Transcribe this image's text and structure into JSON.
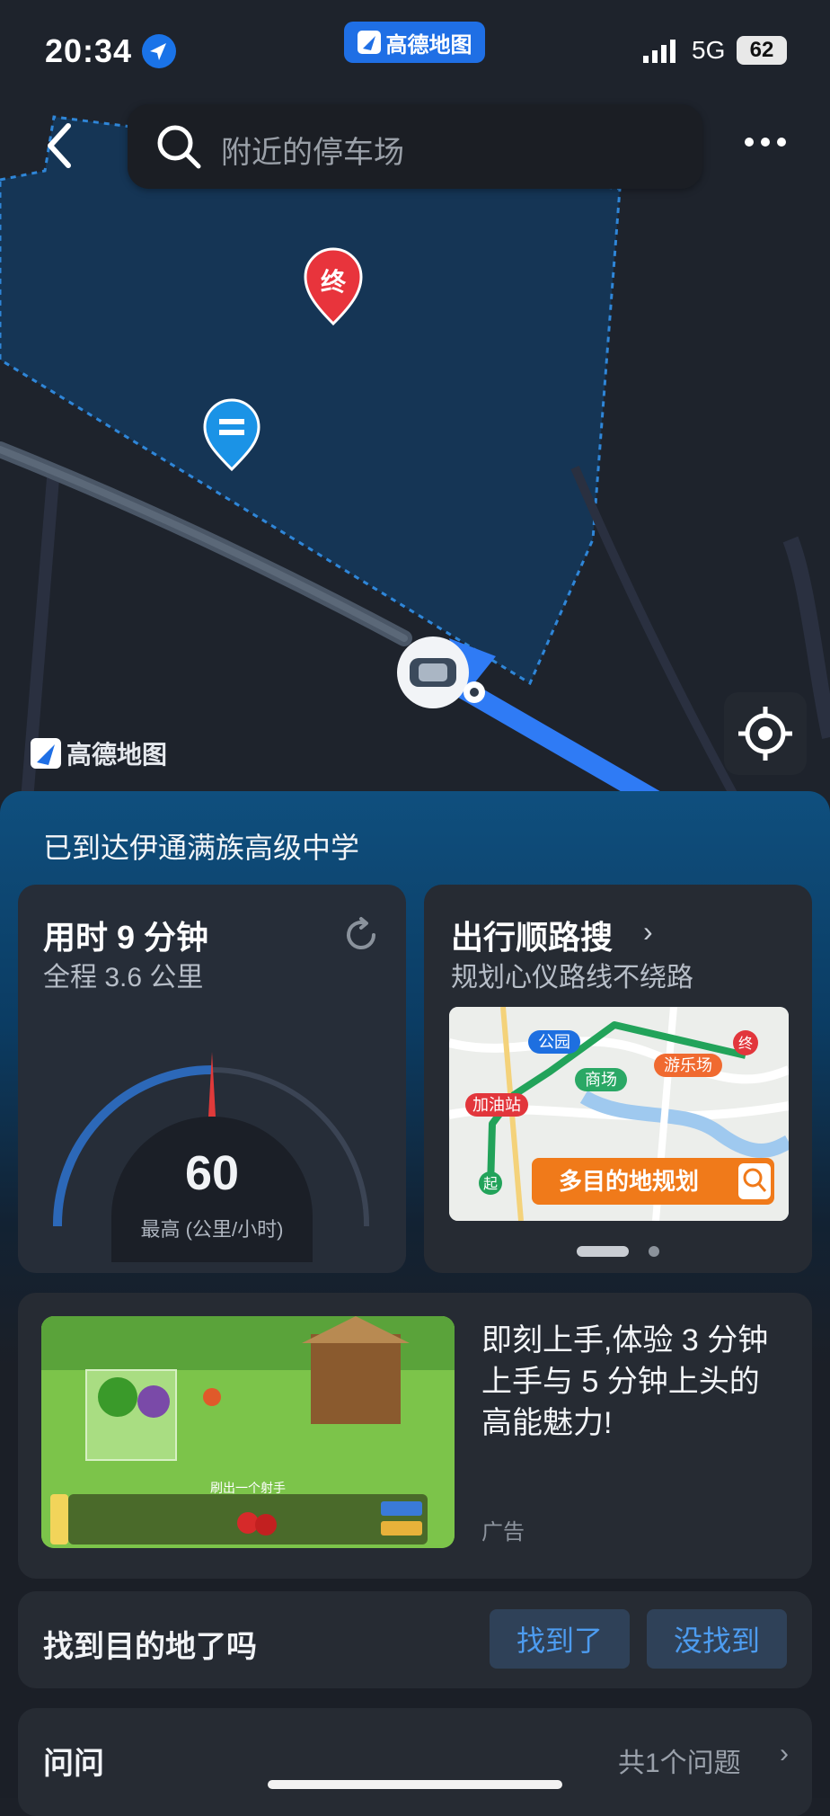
{
  "status_bar": {
    "time": "20:34",
    "app_name": "高德地图",
    "network": "5G",
    "battery": "62"
  },
  "search": {
    "placeholder": "附近的停车场"
  },
  "map": {
    "logo_text": "高德地图",
    "destination_marker": "终",
    "icons": [
      "back-arrow-icon",
      "search-icon",
      "more-dots-icon",
      "locate-icon",
      "car-icon",
      "transit-marker-icon"
    ]
  },
  "panel": {
    "arrived_text": "已到达伊通满族高级中学",
    "trip": {
      "duration": "用时 9 分钟",
      "distance": "全程 3.6 公里",
      "max_speed": "60",
      "speed_unit": "最高 (公里/小时)"
    },
    "route_search": {
      "title": "出行顺路搜",
      "subtitle": "规划心仪路线不绕路",
      "map_labels": {
        "park": "公园",
        "mall": "商场",
        "amusement": "游乐场",
        "gas": "加油站",
        "start": "起",
        "end": "终"
      },
      "banner": "多目的地规划"
    },
    "ad": {
      "text": "即刻上手,体验 3 分钟上手与 5 分钟上头的高能魅力!",
      "label": "广告",
      "game_caption": "刷出一个射手"
    },
    "found": {
      "question": "找到目的地了吗",
      "yes": "找到了",
      "no": "没找到"
    },
    "ask": {
      "title": "问问",
      "count": "共1个问题"
    }
  },
  "colors": {
    "accent_blue": "#1f6fe5",
    "route_blue": "#2f7bf5",
    "marker_red": "#e8343c",
    "button_text": "#4d9cf0",
    "banner_orange": "#f07a1a"
  }
}
